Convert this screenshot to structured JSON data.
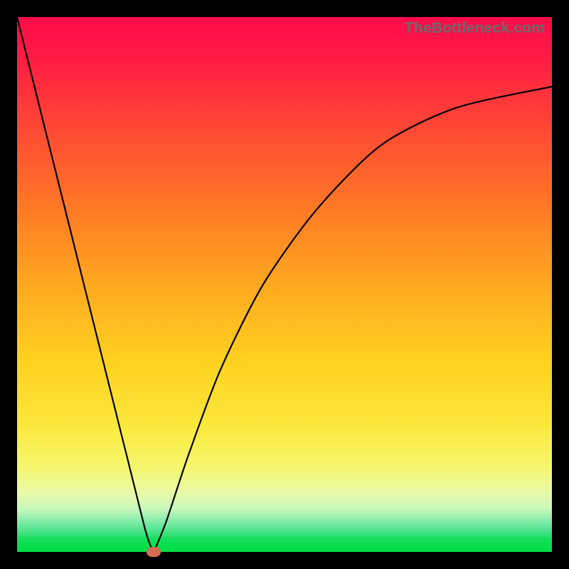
{
  "watermark": "TheBottleneck.com",
  "chart_data": {
    "type": "line",
    "title": "",
    "xlabel": "",
    "ylabel": "",
    "xlim": [
      0,
      100
    ],
    "ylim": [
      0,
      100
    ],
    "series": [
      {
        "name": "curve",
        "x": [
          0,
          4,
          8,
          12,
          16,
          20,
          22,
          24,
          25,
          25.5,
          26,
          28,
          32,
          38,
          46,
          56,
          68,
          82,
          100
        ],
        "y": [
          100,
          84,
          68,
          52,
          36,
          20,
          12,
          4,
          1,
          0,
          1,
          6,
          18,
          34,
          50,
          64,
          76,
          83,
          87
        ]
      }
    ],
    "marker": {
      "x": 25.5,
      "y": 0,
      "color": "#d66b56"
    },
    "gradient_stops": [
      {
        "pos": 0,
        "color": "#ff0b4a"
      },
      {
        "pos": 22,
        "color": "#ff4c33"
      },
      {
        "pos": 50,
        "color": "#ffa81f"
      },
      {
        "pos": 76,
        "color": "#fbe73a"
      },
      {
        "pos": 92,
        "color": "#c7f7bc"
      },
      {
        "pos": 100,
        "color": "#00de45"
      }
    ]
  }
}
